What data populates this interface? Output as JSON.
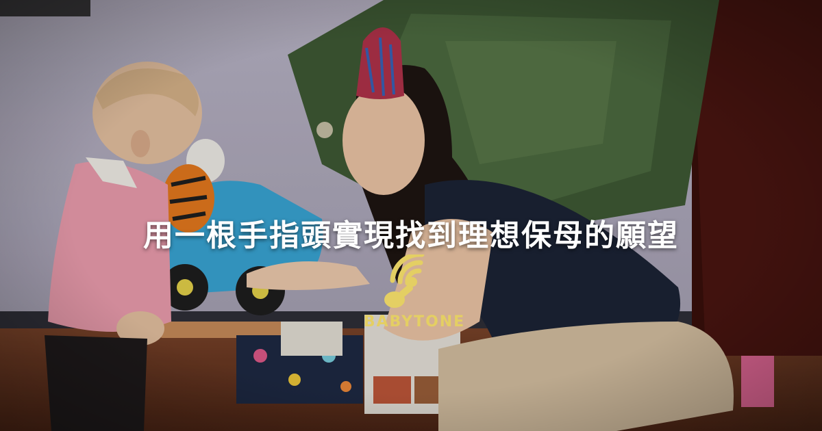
{
  "headline": "用一根手指頭實現找到理想保母的願望",
  "logo": {
    "text": "BABYTONE",
    "icon": "wifi-pacifier-logo-icon",
    "color": "#e4cf63"
  },
  "colors": {
    "wall": "#b9b3c6",
    "floor": "#6a3a25",
    "tree": "#3f5a35",
    "curtain": "#4a1510"
  }
}
